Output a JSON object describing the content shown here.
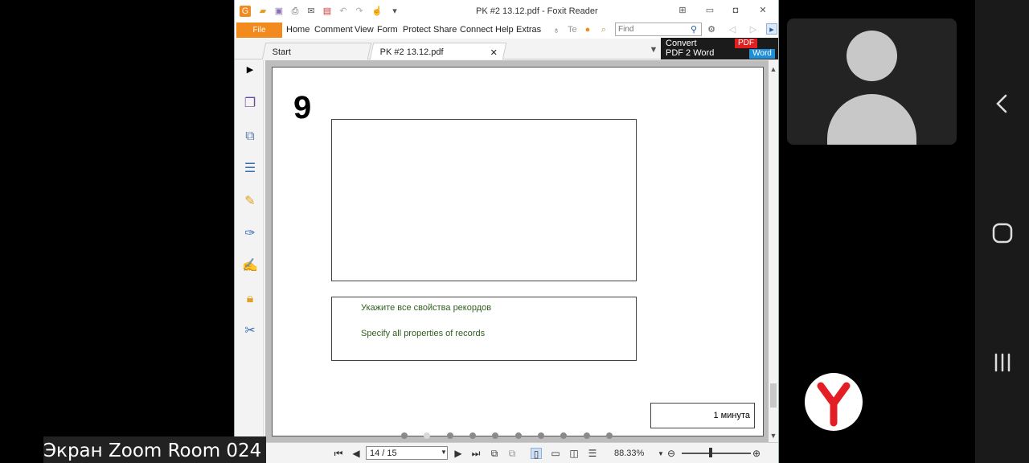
{
  "window": {
    "title": "PK #2 13.12.pdf - Foxit Reader"
  },
  "menu": {
    "file": "File",
    "items": [
      "Home",
      "Comment",
      "View",
      "Form",
      "Protect",
      "Share",
      "Connect",
      "Help",
      "Extras"
    ],
    "tell_me": "Te",
    "find_placeholder": "Find"
  },
  "convert_ad": {
    "line1": "Convert",
    "line2": "PDF 2 Word",
    "pdf_badge": "PDF",
    "word_badge": "Word"
  },
  "tabs": [
    {
      "label": "Start"
    },
    {
      "label": "PK #2 13.12.pdf"
    }
  ],
  "document": {
    "slide_number": "9",
    "question_ru": "Укажите все свойства рекордов",
    "question_en": "Specify all properties of records",
    "timer": "1 минута"
  },
  "status": {
    "page": "14 / 15",
    "zoom": "88.33%"
  },
  "zoom_room": {
    "label": "Экран Zoom Room 024"
  },
  "colors": {
    "file_orange": "#f28a1d",
    "question_green": "#2e5f1e",
    "yandex_red": "#e31e24"
  }
}
